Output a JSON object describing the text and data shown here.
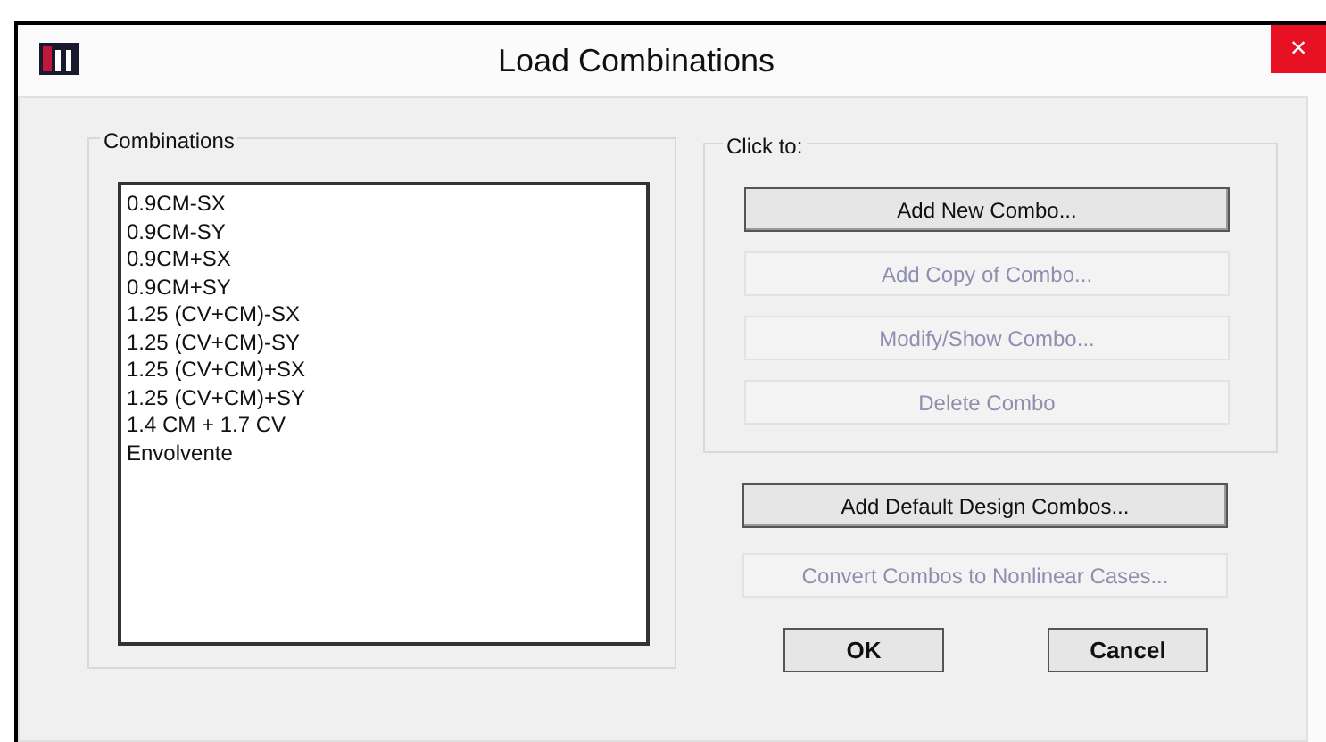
{
  "window": {
    "title": "Load Combinations",
    "close": "×"
  },
  "combinations": {
    "label": "Combinations",
    "items": [
      "0.9CM-SX",
      "0.9CM-SY",
      "0.9CM+SX",
      "0.9CM+SY",
      "1.25 (CV+CM)-SX",
      "1.25 (CV+CM)-SY",
      "1.25 (CV+CM)+SX",
      "1.25 (CV+CM)+SY",
      "1.4 CM + 1.7 CV",
      "Envolvente"
    ]
  },
  "click_to": {
    "label": "Click to:",
    "buttons": [
      {
        "label": "Add New Combo...",
        "disabled": false
      },
      {
        "label": "Add Copy of Combo...",
        "disabled": true
      },
      {
        "label": "Modify/Show Combo...",
        "disabled": true
      },
      {
        "label": "Delete Combo",
        "disabled": true
      }
    ]
  },
  "extra_buttons": [
    {
      "label": "Add Default Design Combos...",
      "disabled": false
    },
    {
      "label": "Convert Combos to Nonlinear Cases...",
      "disabled": true
    }
  ],
  "footer_buttons": [
    {
      "label": "OK"
    },
    {
      "label": "Cancel"
    }
  ]
}
